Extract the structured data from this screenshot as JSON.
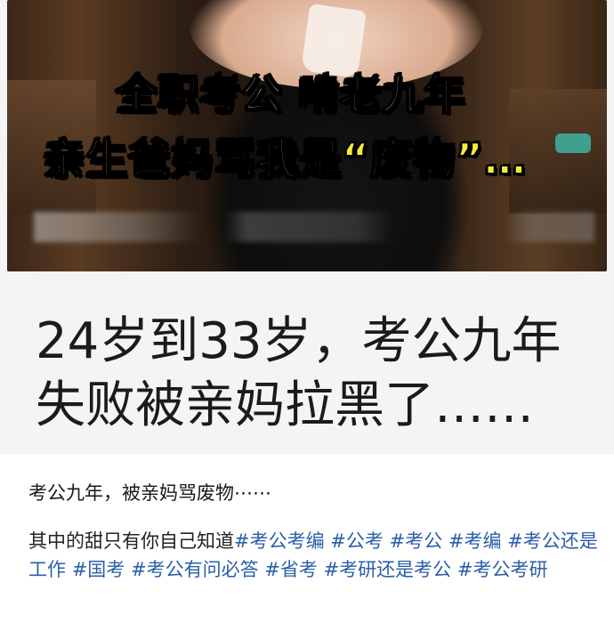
{
  "cover": {
    "overlay_line_1": "全职考公 啃老九年",
    "overlay_line_2": "亲生爸妈骂我是“废物”…",
    "headline_line_1": "24岁到33岁，考公九年",
    "headline_line_2": "失败被亲妈拉黑了……"
  },
  "post": {
    "title": "考公九年，被亲妈骂废物⋯⋯",
    "body_lead": "其中的甜只有你自己知道",
    "tags": [
      "#考公考编",
      "#公考",
      "#考公",
      "#考编",
      "#考公还是工作",
      "#国考",
      "#考公有问必答",
      "#省考",
      "#考研还是考公",
      "#考公考研"
    ]
  },
  "colors": {
    "tag_blue": "#2b5ea8",
    "overlay_yellow": "#f5ec3a",
    "overlay_white": "#ffffff"
  }
}
